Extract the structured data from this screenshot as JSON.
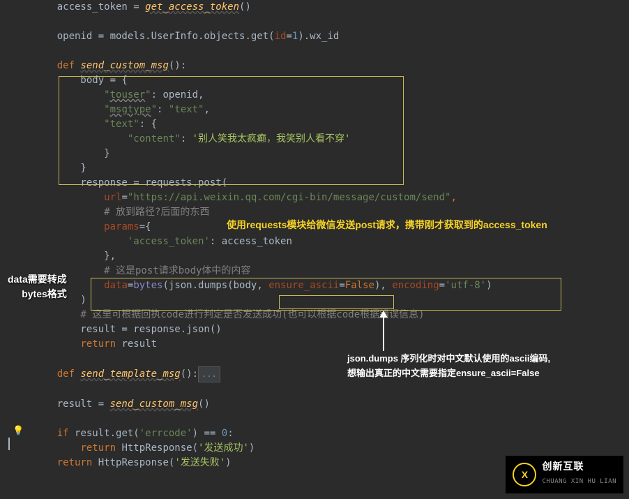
{
  "code": {
    "l1_a": "access_token = ",
    "l1_b": "get_access_token",
    "l1_c": "()",
    "l3_a": "openid = models.UserInfo.objects.get(",
    "l3_b": "id",
    "l3_c": "=",
    "l3_d": "1",
    "l3_e": ").wx_id",
    "l5_a": "def ",
    "l5_b": "send_custom_msg",
    "l5_c": "():",
    "l6": "    body = {",
    "l7_a": "        ",
    "l7_b": "\"",
    "l7_c": "touser",
    "l7_d": "\"",
    "l7_e": ": openid,",
    "l8_a": "        ",
    "l8_b": "\"",
    "l8_c": "msgtype",
    "l8_d": "\"",
    "l8_e": ": ",
    "l8_f": "\"text\"",
    "l8_g": ",",
    "l9_a": "        ",
    "l9_b": "\"text\"",
    "l9_c": ": {",
    "l10_a": "            ",
    "l10_b": "\"content\"",
    "l10_c": ": ",
    "l10_d": "'别人笑我太疯癫，我笑别人看不穿'",
    "l11": "        }",
    "l12": "    }",
    "l13_a": "    response = requests.post(",
    "l14_a": "        ",
    "l14_b": "url",
    "l14_c": "=",
    "l14_d": "\"https://api.weixin.qq.com/cgi-bin/message/custom/send\"",
    "l14_e": ",",
    "l15": "        # 放到路径?后面的东西",
    "l16_a": "        ",
    "l16_b": "params",
    "l16_c": "={",
    "l17_a": "            ",
    "l17_b": "'access_token'",
    "l17_c": ": access_token",
    "l18": "        },",
    "l19": "        # 这是post请求body体中的内容",
    "l20_a": "        ",
    "l20_b": "data",
    "l20_c": "=",
    "l20_d": "bytes",
    "l20_e": "(json.dumps(body, ",
    "l20_f": "ensure_ascii",
    "l20_g": "=",
    "l20_h": "False",
    "l20_i": "), ",
    "l20_j": "encoding",
    "l20_k": "=",
    "l20_l": "'utf-8'",
    "l20_m": ")",
    "l21": "    )",
    "l22": "    # 这里可根据回执code进行判定是否发送成功(也可以根据code根据错误信息)",
    "l23": "    result = response.json()",
    "l24_a": "    ",
    "l24_b": "return ",
    "l24_c": "result",
    "l26_a": "def ",
    "l26_b": "send_template_msg",
    "l26_c": "():",
    "l26_d": "...",
    "l28_a": "result = ",
    "l28_b": "send_custom_msg",
    "l28_c": "()",
    "l30_a": "if ",
    "l30_b": "result.get(",
    "l30_c": "'errcode'",
    "l30_d": ") == ",
    "l30_e": "0",
    "l30_f": ":",
    "l31_a": "    ",
    "l31_b": "return ",
    "l31_c": "HttpResponse(",
    "l31_d": "'发送成功'",
    "l31_e": ")",
    "l32_a": "return ",
    "l32_b": "HttpResponse(",
    "l32_c": "'发送失败'",
    "l32_d": ")"
  },
  "annotations": {
    "a1": "使用requests模块给微信发送post请求，携带刚才获取到的access_token",
    "a2_l1": "data需要转成",
    "a2_l2": "bytes格式",
    "a3_l1": "json.dumps 序列化时对中文默认使用的ascii编码,",
    "a3_l2": "想输出真正的中文需要指定ensure_ascii=False"
  },
  "logo": {
    "brand": "创新互联",
    "sub": "CHUANG XIN HU LIAN",
    "icon": "X"
  }
}
